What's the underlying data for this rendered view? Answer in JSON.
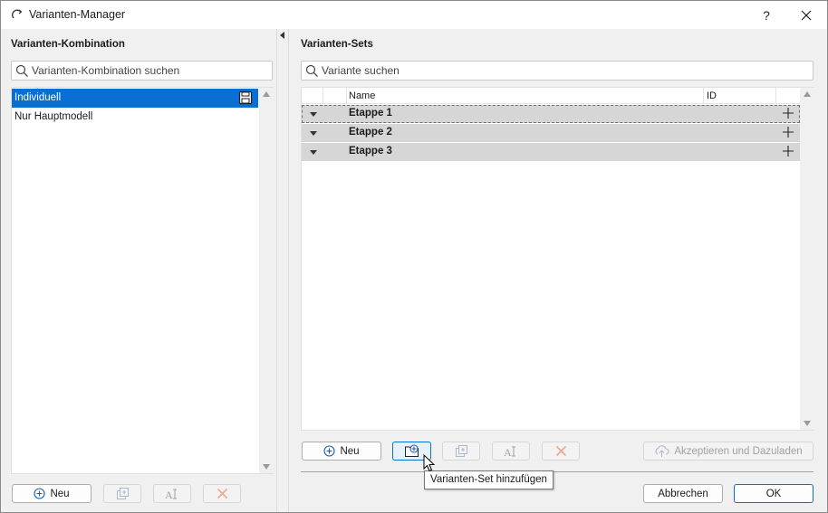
{
  "window": {
    "title": "Varianten-Manager",
    "help_label": "?",
    "close_label": "✕"
  },
  "left": {
    "title": "Varianten-Kombination",
    "search_placeholder": "Varianten-Kombination suchen",
    "items": [
      {
        "label": "Individuell",
        "selected": true
      },
      {
        "label": "Nur Hauptmodell",
        "selected": false
      }
    ],
    "buttons": {
      "new_label": "Neu"
    }
  },
  "right": {
    "title": "Varianten-Sets",
    "search_placeholder": "Variante suchen",
    "columns": {
      "name": "Name",
      "id": "ID"
    },
    "rows": [
      {
        "label": "Etappe 1"
      },
      {
        "label": "Etappe 2"
      },
      {
        "label": "Etappe 3"
      }
    ],
    "buttons": {
      "new_label": "Neu",
      "accept_reload_label": "Akzeptieren und Dazuladen"
    },
    "tooltip": "Varianten-Set hinzufügen"
  },
  "footer": {
    "cancel_label": "Abbrechen",
    "ok_label": "OK"
  },
  "colors": {
    "selection": "#0a6fd4",
    "row_background": "#d6d6d6",
    "delete_icon": "#e07050"
  },
  "icons": [
    "refresh-icon",
    "help-icon",
    "close-icon",
    "search-icon",
    "save-icon",
    "add-circle-icon",
    "duplicate-icon",
    "rename-icon",
    "delete-icon",
    "folder-add-icon",
    "upload-icon",
    "expand-caret-icon",
    "plus-icon",
    "mouse-cursor-icon"
  ]
}
